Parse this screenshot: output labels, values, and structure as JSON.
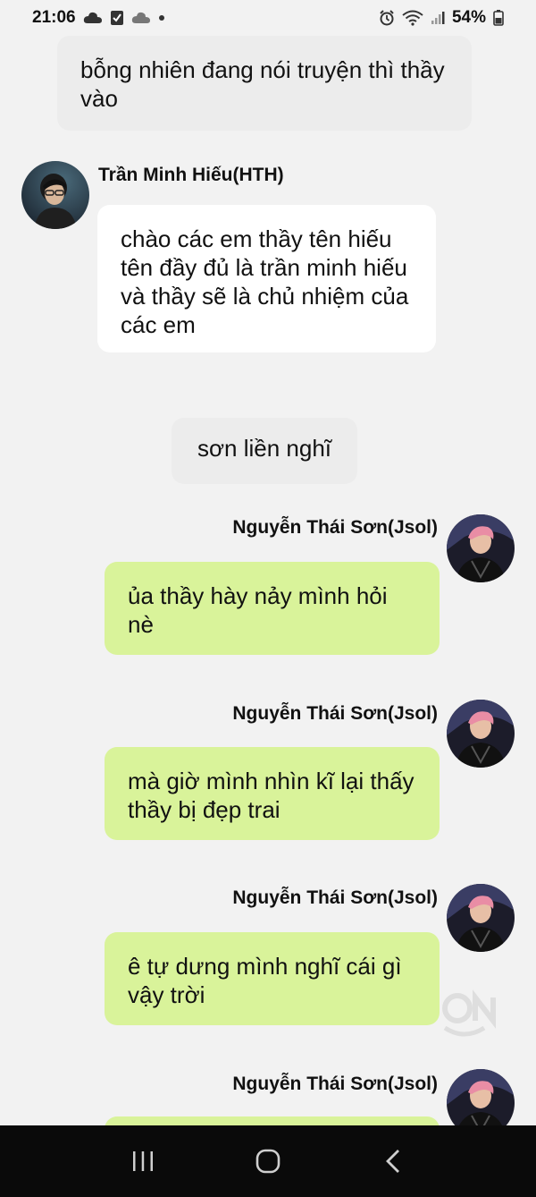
{
  "status_bar": {
    "time": "21:06",
    "battery": "54%",
    "icons_left": [
      "cloud-icon",
      "checkbox-icon",
      "cloud-icon",
      "dot-icon"
    ],
    "icons_right": [
      "alarm-icon",
      "wifi-icon",
      "signal-icon",
      "battery-icon"
    ]
  },
  "messages": [
    {
      "kind": "narration",
      "text": "bỗng nhiên đang nói truyện thì thầy vào"
    },
    {
      "kind": "incoming",
      "sender": "Trần Minh Hiếu(HTH)",
      "text": "chào các em thầy tên hiếu tên đầy đủ là trần minh hiếu và thầy sẽ là chủ nhiệm của các em"
    },
    {
      "kind": "narration",
      "text": "sơn liền nghĩ"
    },
    {
      "kind": "outgoing",
      "sender": "Nguyễn Thái Sơn(Jsol)",
      "text": "ủa thầy hày nảy mình hỏi nè"
    },
    {
      "kind": "outgoing",
      "sender": "Nguyễn Thái Sơn(Jsol)",
      "text": "mà giờ mình nhìn kĩ lại thấy thầy bị đẹp trai"
    },
    {
      "kind": "outgoing",
      "sender": "Nguyễn Thái Sơn(Jsol)",
      "text": "ê tự dưng mình nghĩ cái gì vậy trời"
    },
    {
      "kind": "outgoing",
      "sender": "Nguyễn Thái Sơn(Jsol)",
      "text": ""
    }
  ],
  "nav_bar": {
    "icons": [
      "recent-apps-icon",
      "home-icon",
      "back-icon"
    ]
  },
  "colors": {
    "background": "#f2f2f2",
    "narration_bubble": "#ececec",
    "incoming_bubble": "#ffffff",
    "outgoing_bubble": "#d9f39a",
    "nav_bar": "#0a0a0a"
  }
}
